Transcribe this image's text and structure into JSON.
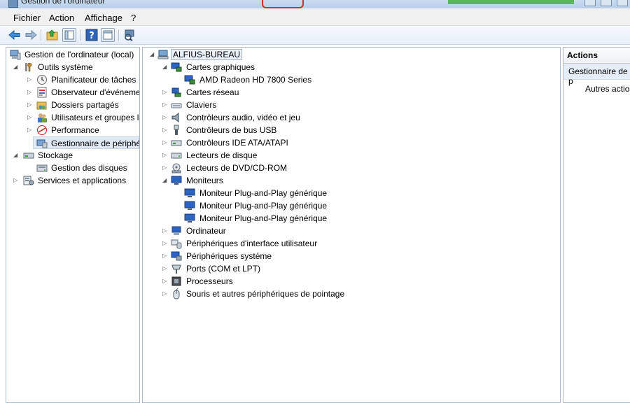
{
  "window": {
    "title": "Gestion de l'ordinateur"
  },
  "menu": [
    "Fichier",
    "Action",
    "Affichage",
    "?"
  ],
  "toolbar": {
    "icons": [
      "back-arrow-icon",
      "forward-arrow-icon",
      "up-folder-icon",
      "show-hide-tree-icon",
      "help-icon",
      "show-hide-action-pane-icon",
      "scan-hardware-icon"
    ]
  },
  "left_tree": {
    "root": "Gestion de l'ordinateur (local)",
    "outils": "Outils système",
    "planificateur": "Planificateur de tâches",
    "observateur": "Observateur d'événeme",
    "dossiers": "Dossiers partagés",
    "utilisateurs": "Utilisateurs et groupes l",
    "performance": "Performance",
    "gestionnaire": "Gestionnaire de périphé",
    "stockage": "Stockage",
    "disques": "Gestion des disques",
    "services": "Services et applications"
  },
  "device_tree": {
    "root": "ALFIUS-BUREAU",
    "cartes_graphiques": "Cartes graphiques",
    "amd": "AMD Radeon HD 7800 Series",
    "cartes_reseau": "Cartes réseau",
    "claviers": "Claviers",
    "audio": "Contrôleurs audio, vidéo et jeu",
    "usb": "Contrôleurs de bus USB",
    "ide": "Contrôleurs IDE ATA/ATAPI",
    "disque": "Lecteurs de disque",
    "dvd": "Lecteurs de DVD/CD-ROM",
    "moniteurs": "Moniteurs",
    "moniteur1": "Moniteur Plug-and-Play générique",
    "moniteur2": "Moniteur Plug-and-Play générique",
    "moniteur3": "Moniteur Plug-and-Play générique",
    "ordinateur": "Ordinateur",
    "hid": "Périphériques d'interface utilisateur",
    "systeme": "Périphériques système",
    "ports": "Ports (COM et LPT)",
    "processeurs": "Processeurs",
    "souris": "Souris et autres périphériques de pointage"
  },
  "actions": {
    "header": "Actions",
    "selected": "Gestionnaire de p",
    "more": "Autres actio"
  }
}
